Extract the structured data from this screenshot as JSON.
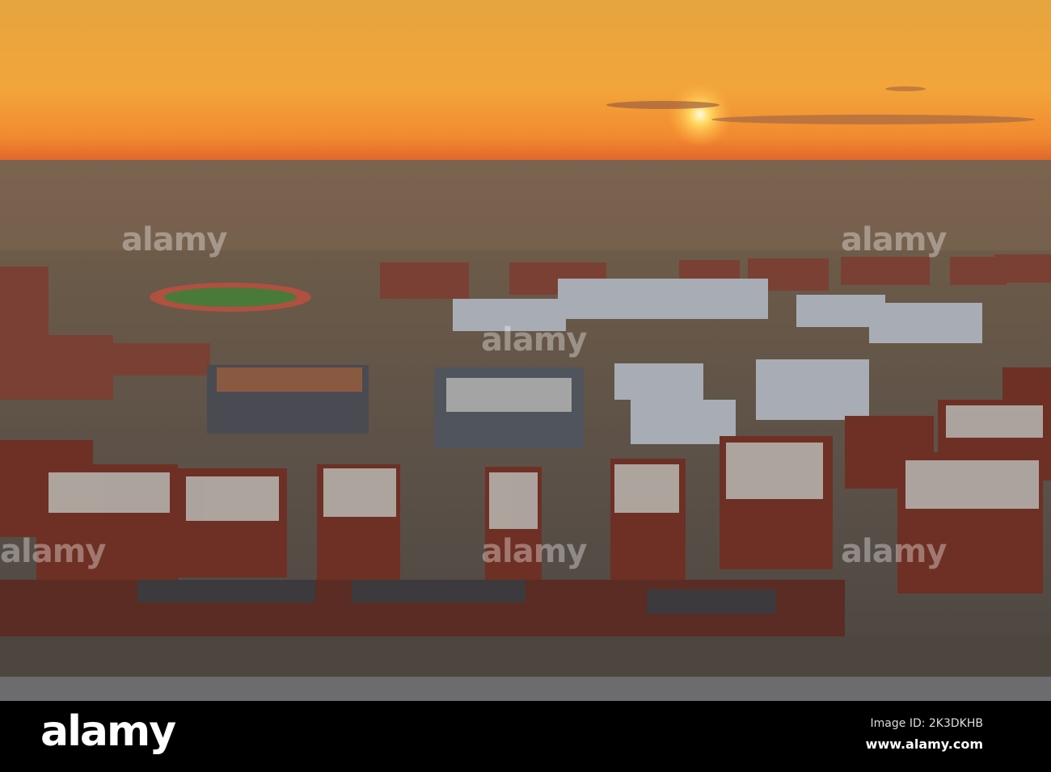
{
  "photo": {
    "subject": "aerial campus at sunset",
    "colors": {
      "sky_top": "#e8a63c",
      "sky_horizon": "#ee6f2a",
      "sun": "#fff4c0",
      "ground": "#6a5846",
      "brick": "#7a3a2c",
      "roof": "#c8c8c4",
      "road": "#6c6c6e"
    }
  },
  "watermark": {
    "logo": "alamy"
  },
  "footer": {
    "logo": "alamy",
    "image_id": "Image ID: 2K3DKHB",
    "site": "www.alamy.com"
  }
}
